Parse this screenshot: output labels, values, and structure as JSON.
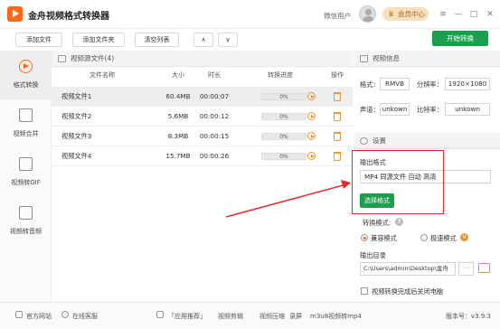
{
  "app": {
    "title": "金舟视频格式转换器",
    "wechat_user": "微信用户",
    "vip": "会员中心"
  },
  "window_controls": [
    "≡",
    "—",
    "□",
    "✕"
  ],
  "toolbar": {
    "add_file": "添加文件",
    "add_folder": "添加文件夹",
    "clear_list": "清空列表",
    "up": "∧",
    "down": "∨",
    "start": "开始转换"
  },
  "nav": [
    {
      "label": "格式转换",
      "icon": "convert-icon",
      "active": true
    },
    {
      "label": "视频合并",
      "icon": "merge-icon",
      "active": false
    },
    {
      "label": "视频转GIF",
      "icon": "gif-icon",
      "active": false
    },
    {
      "label": "视频转音频",
      "icon": "audio-icon",
      "active": false
    }
  ],
  "list": {
    "section_title": "视频源文件(4)",
    "headers": {
      "name": "文件名称",
      "size": "大小",
      "duration": "时长",
      "progress": "转换进度",
      "action": "操作"
    },
    "rows": [
      {
        "name": "视频文件1",
        "size": "60.4MB",
        "duration": "00:00:07",
        "progress": "0%"
      },
      {
        "name": "视频文件2",
        "size": "5.6MB",
        "duration": "00:00:12",
        "progress": "0%"
      },
      {
        "name": "视频文件3",
        "size": "8.3MB",
        "duration": "00:00:15",
        "progress": "0%"
      },
      {
        "name": "视频文件4",
        "size": "15.7MB",
        "duration": "00:00:26",
        "progress": "0%"
      }
    ]
  },
  "info": {
    "title": "视频信息",
    "format_label": "格式：",
    "format_value": "RMVB",
    "resolution_label": "分辨率：",
    "resolution_value": "1920×1080",
    "channel_label": "声道：",
    "channel_value": "unkown",
    "bitrate_label": "比特率：",
    "bitrate_value": "unkown"
  },
  "settings": {
    "title": "设置",
    "output_format_label": "输出格式",
    "output_format_value": "MP4 同源文件 自动 高清",
    "choose_format": "选择格式",
    "mode_label": "转换模式:",
    "mode_compat": "兼容模式",
    "mode_fast": "极速模式",
    "vip_badge": "V",
    "output_dir_label": "输出目录",
    "output_dir_value": "C:\\Users\\admin\\Desktop\\金舟",
    "more": "···",
    "close_after": "视频转换完成后关闭电脑"
  },
  "status": {
    "website": "官方网站",
    "support": "在线客服",
    "recommend": "「应用推荐」",
    "links": [
      "视频剪辑",
      "视频压缩",
      "录屏",
      "m3u8视频转mp4"
    ],
    "version": "版本号：v3.9.3"
  },
  "colors": {
    "accent": "#ff6a16",
    "green": "#1aa04c",
    "annotation": "#e62828"
  }
}
